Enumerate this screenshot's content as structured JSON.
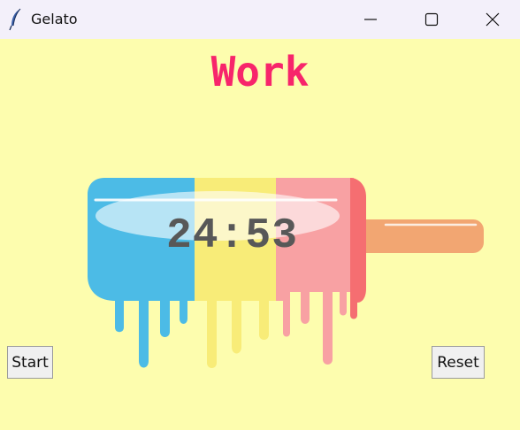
{
  "window": {
    "title": "Gelato"
  },
  "titlebar": {
    "icons": {
      "app": "feather-icon",
      "minimize": "minimize-icon",
      "maximize": "maximize-icon",
      "close": "close-icon"
    }
  },
  "main": {
    "heading": "Work",
    "timer": "24:53",
    "start_label": "Start",
    "reset_label": "Reset"
  },
  "colors": {
    "background": "#fdfdae",
    "heading": "#f7256b",
    "timer": "#585858",
    "popsicle_blue": "#4cbbe6",
    "popsicle_yellow": "#f8ec78",
    "popsicle_pink": "#f8a1a3",
    "popsicle_red": "#f56e71",
    "stick": "#f2a672"
  }
}
